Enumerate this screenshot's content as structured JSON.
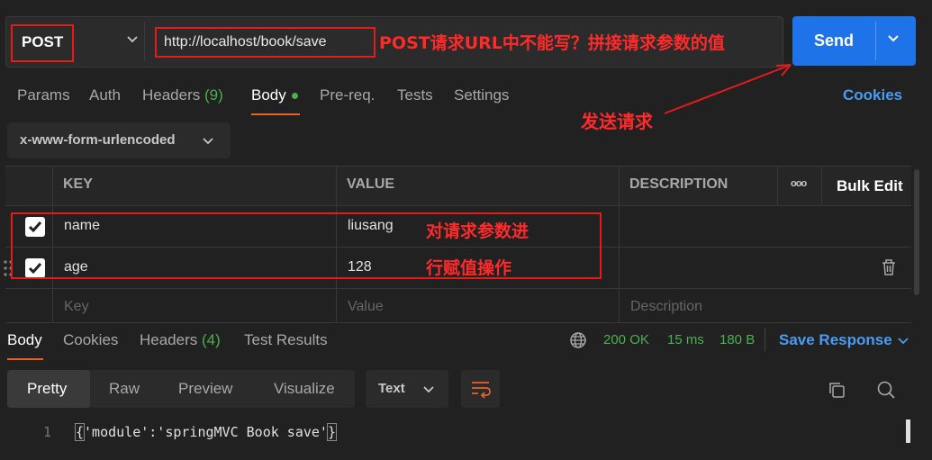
{
  "request": {
    "method": "POST",
    "url": "http://localhost/book/save",
    "send_label": "Send"
  },
  "annotations": {
    "url_note": "POST请求URL中不能写？拼接请求参数的值",
    "send_note": "发送请求",
    "params_note_line1": "对请求参数进",
    "params_note_line2": "行赋值操作"
  },
  "tabs": {
    "params": "Params",
    "auth": "Auth",
    "headers": "Headers",
    "headers_count": "(9)",
    "body": "Body",
    "prereq": "Pre-req.",
    "tests": "Tests",
    "settings": "Settings",
    "cookies": "Cookies"
  },
  "body_type": "x-www-form-urlencoded",
  "table": {
    "headers": {
      "key": "KEY",
      "value": "VALUE",
      "description": "DESCRIPTION",
      "more": "ooo",
      "bulk_edit": "Bulk Edit"
    },
    "rows": [
      {
        "key": "name",
        "value": "liusang",
        "checked": true
      },
      {
        "key": "age",
        "value": "128",
        "checked": true
      }
    ],
    "placeholders": {
      "key": "Key",
      "value": "Value",
      "description": "Description"
    }
  },
  "response": {
    "tabs": {
      "body": "Body",
      "cookies": "Cookies",
      "headers": "Headers",
      "headers_count": "(4)",
      "test_results": "Test Results"
    },
    "status": "200 OK",
    "time": "15 ms",
    "size": "180 B",
    "save_response": "Save Response",
    "view_modes": [
      "Pretty",
      "Raw",
      "Preview",
      "Visualize"
    ],
    "format": "Text",
    "line_number": "1",
    "open_brace": "{",
    "code_text": "'module':'springMVC Book save'",
    "close_brace": "}"
  },
  "colors": {
    "accent_blue": "#1e73e8",
    "status_green": "#4caf50",
    "active_orange": "#e86228",
    "annotation_red": "#e21b1b"
  }
}
